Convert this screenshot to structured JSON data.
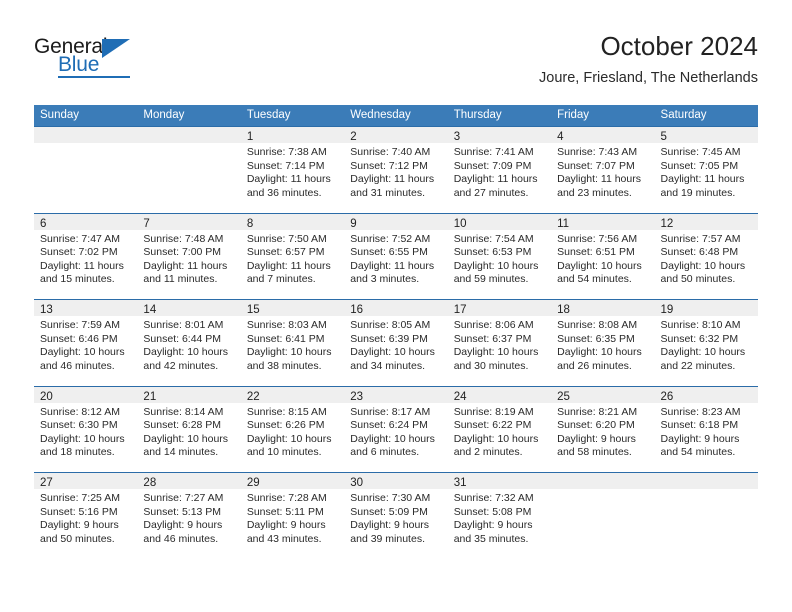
{
  "brand": {
    "name_top": "General",
    "name_bottom": "Blue",
    "accent_color": "#1f6db5"
  },
  "header": {
    "title": "October 2024",
    "location": "Joure, Friesland, The Netherlands"
  },
  "theme": {
    "header_band_color": "#3b7cb8",
    "week_divider_color": "#2b6ca8",
    "day_band_color": "#efefef"
  },
  "weekdays": [
    "Sunday",
    "Monday",
    "Tuesday",
    "Wednesday",
    "Thursday",
    "Friday",
    "Saturday"
  ],
  "weeks": [
    [
      {
        "day": "",
        "blank": true,
        "sunrise": "",
        "sunset": "",
        "daylight": ""
      },
      {
        "day": "",
        "blank": true,
        "sunrise": "",
        "sunset": "",
        "daylight": ""
      },
      {
        "day": "1",
        "sunrise": "Sunrise: 7:38 AM",
        "sunset": "Sunset: 7:14 PM",
        "daylight": "Daylight: 11 hours and 36 minutes."
      },
      {
        "day": "2",
        "sunrise": "Sunrise: 7:40 AM",
        "sunset": "Sunset: 7:12 PM",
        "daylight": "Daylight: 11 hours and 31 minutes."
      },
      {
        "day": "3",
        "sunrise": "Sunrise: 7:41 AM",
        "sunset": "Sunset: 7:09 PM",
        "daylight": "Daylight: 11 hours and 27 minutes."
      },
      {
        "day": "4",
        "sunrise": "Sunrise: 7:43 AM",
        "sunset": "Sunset: 7:07 PM",
        "daylight": "Daylight: 11 hours and 23 minutes."
      },
      {
        "day": "5",
        "sunrise": "Sunrise: 7:45 AM",
        "sunset": "Sunset: 7:05 PM",
        "daylight": "Daylight: 11 hours and 19 minutes."
      }
    ],
    [
      {
        "day": "6",
        "sunrise": "Sunrise: 7:47 AM",
        "sunset": "Sunset: 7:02 PM",
        "daylight": "Daylight: 11 hours and 15 minutes."
      },
      {
        "day": "7",
        "sunrise": "Sunrise: 7:48 AM",
        "sunset": "Sunset: 7:00 PM",
        "daylight": "Daylight: 11 hours and 11 minutes."
      },
      {
        "day": "8",
        "sunrise": "Sunrise: 7:50 AM",
        "sunset": "Sunset: 6:57 PM",
        "daylight": "Daylight: 11 hours and 7 minutes."
      },
      {
        "day": "9",
        "sunrise": "Sunrise: 7:52 AM",
        "sunset": "Sunset: 6:55 PM",
        "daylight": "Daylight: 11 hours and 3 minutes."
      },
      {
        "day": "10",
        "sunrise": "Sunrise: 7:54 AM",
        "sunset": "Sunset: 6:53 PM",
        "daylight": "Daylight: 10 hours and 59 minutes."
      },
      {
        "day": "11",
        "sunrise": "Sunrise: 7:56 AM",
        "sunset": "Sunset: 6:51 PM",
        "daylight": "Daylight: 10 hours and 54 minutes."
      },
      {
        "day": "12",
        "sunrise": "Sunrise: 7:57 AM",
        "sunset": "Sunset: 6:48 PM",
        "daylight": "Daylight: 10 hours and 50 minutes."
      }
    ],
    [
      {
        "day": "13",
        "sunrise": "Sunrise: 7:59 AM",
        "sunset": "Sunset: 6:46 PM",
        "daylight": "Daylight: 10 hours and 46 minutes."
      },
      {
        "day": "14",
        "sunrise": "Sunrise: 8:01 AM",
        "sunset": "Sunset: 6:44 PM",
        "daylight": "Daylight: 10 hours and 42 minutes."
      },
      {
        "day": "15",
        "sunrise": "Sunrise: 8:03 AM",
        "sunset": "Sunset: 6:41 PM",
        "daylight": "Daylight: 10 hours and 38 minutes."
      },
      {
        "day": "16",
        "sunrise": "Sunrise: 8:05 AM",
        "sunset": "Sunset: 6:39 PM",
        "daylight": "Daylight: 10 hours and 34 minutes."
      },
      {
        "day": "17",
        "sunrise": "Sunrise: 8:06 AM",
        "sunset": "Sunset: 6:37 PM",
        "daylight": "Daylight: 10 hours and 30 minutes."
      },
      {
        "day": "18",
        "sunrise": "Sunrise: 8:08 AM",
        "sunset": "Sunset: 6:35 PM",
        "daylight": "Daylight: 10 hours and 26 minutes."
      },
      {
        "day": "19",
        "sunrise": "Sunrise: 8:10 AM",
        "sunset": "Sunset: 6:32 PM",
        "daylight": "Daylight: 10 hours and 22 minutes."
      }
    ],
    [
      {
        "day": "20",
        "sunrise": "Sunrise: 8:12 AM",
        "sunset": "Sunset: 6:30 PM",
        "daylight": "Daylight: 10 hours and 18 minutes."
      },
      {
        "day": "21",
        "sunrise": "Sunrise: 8:14 AM",
        "sunset": "Sunset: 6:28 PM",
        "daylight": "Daylight: 10 hours and 14 minutes."
      },
      {
        "day": "22",
        "sunrise": "Sunrise: 8:15 AM",
        "sunset": "Sunset: 6:26 PM",
        "daylight": "Daylight: 10 hours and 10 minutes."
      },
      {
        "day": "23",
        "sunrise": "Sunrise: 8:17 AM",
        "sunset": "Sunset: 6:24 PM",
        "daylight": "Daylight: 10 hours and 6 minutes."
      },
      {
        "day": "24",
        "sunrise": "Sunrise: 8:19 AM",
        "sunset": "Sunset: 6:22 PM",
        "daylight": "Daylight: 10 hours and 2 minutes."
      },
      {
        "day": "25",
        "sunrise": "Sunrise: 8:21 AM",
        "sunset": "Sunset: 6:20 PM",
        "daylight": "Daylight: 9 hours and 58 minutes."
      },
      {
        "day": "26",
        "sunrise": "Sunrise: 8:23 AM",
        "sunset": "Sunset: 6:18 PM",
        "daylight": "Daylight: 9 hours and 54 minutes."
      }
    ],
    [
      {
        "day": "27",
        "sunrise": "Sunrise: 7:25 AM",
        "sunset": "Sunset: 5:16 PM",
        "daylight": "Daylight: 9 hours and 50 minutes."
      },
      {
        "day": "28",
        "sunrise": "Sunrise: 7:27 AM",
        "sunset": "Sunset: 5:13 PM",
        "daylight": "Daylight: 9 hours and 46 minutes."
      },
      {
        "day": "29",
        "sunrise": "Sunrise: 7:28 AM",
        "sunset": "Sunset: 5:11 PM",
        "daylight": "Daylight: 9 hours and 43 minutes."
      },
      {
        "day": "30",
        "sunrise": "Sunrise: 7:30 AM",
        "sunset": "Sunset: 5:09 PM",
        "daylight": "Daylight: 9 hours and 39 minutes."
      },
      {
        "day": "31",
        "sunrise": "Sunrise: 7:32 AM",
        "sunset": "Sunset: 5:08 PM",
        "daylight": "Daylight: 9 hours and 35 minutes."
      },
      {
        "day": "",
        "blank": true,
        "sunrise": "",
        "sunset": "",
        "daylight": ""
      },
      {
        "day": "",
        "blank": true,
        "sunrise": "",
        "sunset": "",
        "daylight": ""
      }
    ]
  ]
}
